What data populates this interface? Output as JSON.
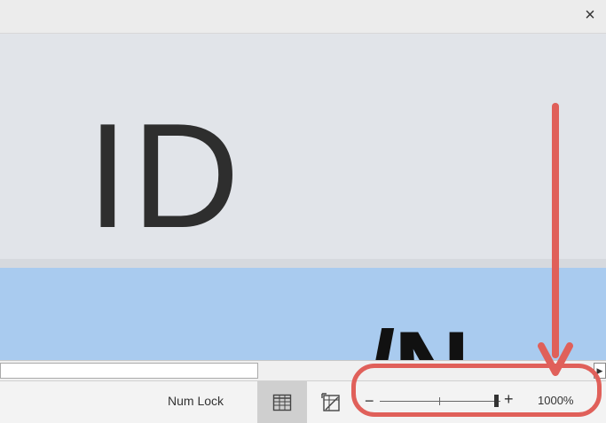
{
  "window": {
    "close_glyph": "×"
  },
  "canvas": {
    "large_text": "ID",
    "partial_text": "/N",
    "colors": {
      "upper": "#e1e4e9",
      "lower": "#a9cbef"
    }
  },
  "status_bar": {
    "num_lock_label": "Num Lock",
    "views": [
      {
        "name": "normal-view",
        "icon": "grid-sheet-icon",
        "active": true
      },
      {
        "name": "page-layout-view",
        "icon": "page-layout-icon",
        "active": false
      }
    ],
    "zoom": {
      "minus_label": "−",
      "plus_label": "+",
      "percent_label": "1000%",
      "level_fraction": 0.97
    }
  },
  "annotation": {
    "color": "#e0605a"
  }
}
